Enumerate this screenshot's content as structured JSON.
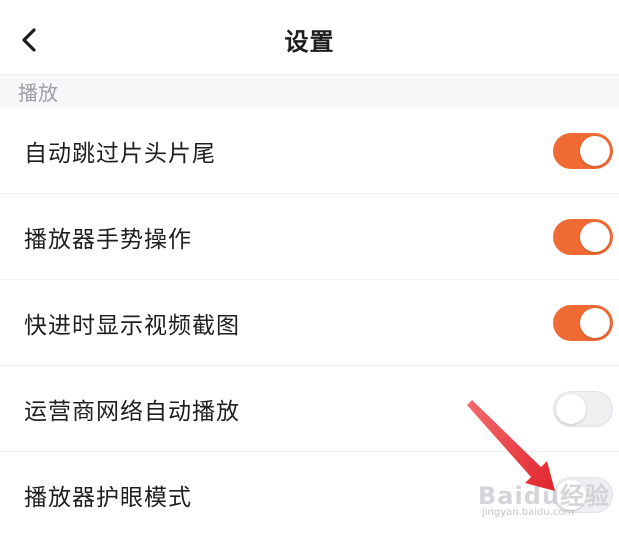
{
  "header": {
    "back_icon": "chevron-left-icon",
    "title": "设置"
  },
  "section": {
    "label": "播放"
  },
  "settings": [
    {
      "label": "自动跳过片头片尾",
      "enabled": true
    },
    {
      "label": "播放器手势操作",
      "enabled": true
    },
    {
      "label": "快进时显示视频截图",
      "enabled": true
    },
    {
      "label": "运营商网络自动播放",
      "enabled": false
    },
    {
      "label": "播放器护眼模式",
      "enabled": false
    }
  ],
  "colors": {
    "toggle_on": "#f06a34",
    "toggle_off": "#eeeff1",
    "arrow": "#e8383d"
  },
  "watermark": {
    "text": "Baidu经验",
    "url": "jingyan.baidu.com"
  }
}
